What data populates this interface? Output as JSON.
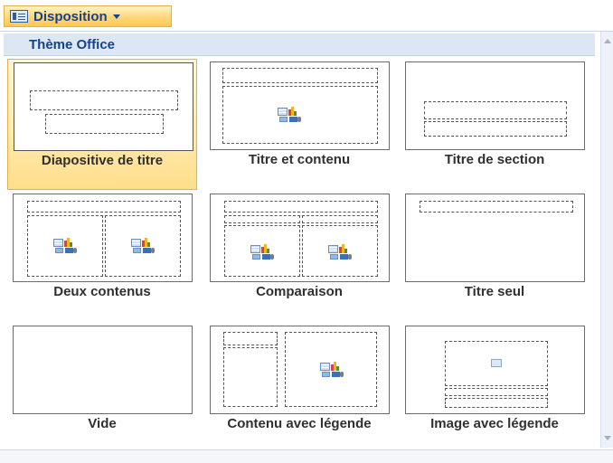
{
  "toolbar": {
    "button_label": "Disposition"
  },
  "gallery": {
    "theme_name": "Thème Office",
    "layouts": [
      {
        "name": "Diapositive de titre",
        "selected": true
      },
      {
        "name": "Titre et contenu",
        "selected": false
      },
      {
        "name": "Titre de section",
        "selected": false
      },
      {
        "name": "Deux contenus",
        "selected": false
      },
      {
        "name": "Comparaison",
        "selected": false
      },
      {
        "name": "Titre seul",
        "selected": false
      },
      {
        "name": "Vide",
        "selected": false
      },
      {
        "name": "Contenu avec légende",
        "selected": false
      },
      {
        "name": "Image avec légende",
        "selected": false
      }
    ]
  },
  "colors": {
    "accent_text": "#15428b",
    "selected_fill": "#ffdf8c",
    "header_fill": "#dde7f4"
  },
  "icons": {
    "button_icon": "layout-icon",
    "content_placeholder": "content-insert-icon",
    "picture_placeholder": "picture-icon"
  }
}
